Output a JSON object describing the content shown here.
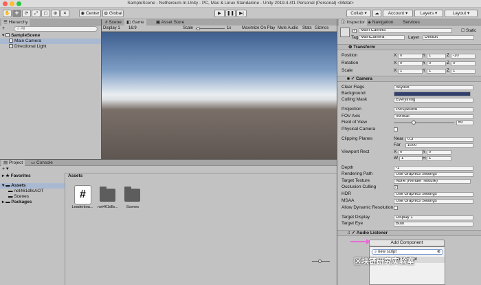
{
  "window": {
    "title": "SampleScene - Nethereum-In-Unity - PC, Mac & Linux Standalone - Unity 2019.4.4f1 Personal (Personal) <Metal>"
  },
  "toolbar": {
    "pivot_label": "Center",
    "space_label": "Global",
    "collab_label": "Collab",
    "account_label": "Account",
    "layers_label": "Layers",
    "layout_label": "Layout"
  },
  "hierarchy": {
    "tab": "Hierarchy",
    "create_label": "+",
    "search_placeholder": "All",
    "items": [
      {
        "label": "SampleScene"
      },
      {
        "label": "Main Camera"
      },
      {
        "label": "Directional Light"
      }
    ]
  },
  "scene_tabs": {
    "scene": "Scene",
    "game": "Game",
    "asset_store": "Asset Store"
  },
  "game_bar": {
    "display": "Display 1",
    "aspect": "16:9",
    "scale_label": "Scale",
    "scale_value": "1x",
    "maximize": "Maximize On Play",
    "mute": "Mute Audio",
    "stats": "Stats",
    "gizmos": "Gizmos"
  },
  "project": {
    "tab_project": "Project",
    "tab_console": "Console",
    "favorites": "Favorites",
    "assets_root": "Assets",
    "tree": [
      "net461dllsAOT",
      "Scenes"
    ],
    "packages": "Packages",
    "assets_header": "Assets",
    "assets": [
      {
        "label": "Leaderboa...",
        "type": "script"
      },
      {
        "label": "net461dlls...",
        "type": "folder"
      },
      {
        "label": "Scenes",
        "type": "folder"
      }
    ],
    "slider_level": 0.45
  },
  "inspector": {
    "tab_inspector": "Inspector",
    "tab_navigation": "Navigation",
    "tab_services": "Services",
    "object_name": "Main Camera",
    "static_label": "Static",
    "tag_label": "Tag",
    "tag_value": "MainCamera",
    "layer_label": "Layer",
    "layer_value": "Default",
    "transform": {
      "title": "Transform",
      "rows": [
        {
          "label": "Position",
          "x": "0",
          "y": "1",
          "z": "-10"
        },
        {
          "label": "Rotation",
          "x": "0",
          "y": "0",
          "z": "0"
        },
        {
          "label": "Scale",
          "x": "1",
          "y": "1",
          "z": "1"
        }
      ]
    },
    "camera": {
      "title": "Camera",
      "clear_flags": {
        "label": "Clear Flags",
        "value": "Skybox"
      },
      "background": {
        "label": "Background",
        "color": "#30406a"
      },
      "culling_mask": {
        "label": "Culling Mask",
        "value": "Everything"
      },
      "projection": {
        "label": "Projection",
        "value": "Perspective"
      },
      "fov_axis": {
        "label": "FOV Axis",
        "value": "Vertical"
      },
      "fov": {
        "label": "Field of View",
        "value": "60",
        "level": 0.33
      },
      "physical": {
        "label": "Physical Camera"
      },
      "clipping": {
        "label": "Clipping Planes",
        "near_label": "Near",
        "near": "0.3",
        "far_label": "Far",
        "far": "1000"
      },
      "viewport": {
        "label": "Viewport Rect",
        "x": "0",
        "y": "0",
        "w": "1",
        "h": "1"
      },
      "depth": {
        "label": "Depth",
        "value": "-1"
      },
      "rendering_path": {
        "label": "Rendering Path",
        "value": "Use Graphics Settings"
      },
      "target_texture": {
        "label": "Target Texture",
        "value": "None (Render Texture)"
      },
      "occlusion": {
        "label": "Occlusion Culling"
      },
      "hdr": {
        "label": "HDR",
        "value": "Use Graphics Settings"
      },
      "msaa": {
        "label": "MSAA",
        "value": "Use Graphics Settings"
      },
      "dynamic_res": {
        "label": "Allow Dynamic Resolution"
      },
      "target_display": {
        "label": "Target Display",
        "value": "Display 1"
      },
      "target_eye": {
        "label": "Target Eye",
        "value": "Both"
      }
    },
    "audio_listener": "Audio Listener",
    "add_component": "Add Component",
    "search_value": "new script",
    "new_script_value": "New Script"
  },
  "watermark": "区块链研究实验室",
  "colors": {
    "accent_pink": "#e86ad8",
    "selection": "#aab9d2"
  }
}
